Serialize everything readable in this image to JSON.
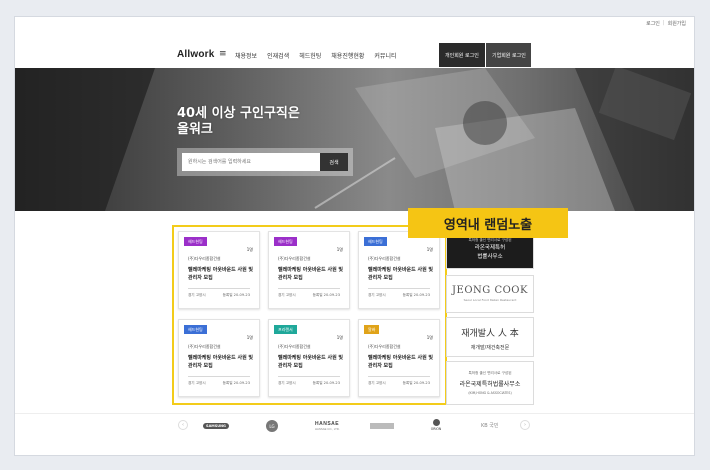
{
  "util": {
    "login": "로그인",
    "join": "회원가입"
  },
  "header": {
    "logo": "Allwork",
    "nav": [
      "채용정보",
      "인재검색",
      "헤드헌팅",
      "채용진행현황",
      "커뮤니티"
    ],
    "login_personal": "개인회원 로그인",
    "login_company": "기업회원 로그인"
  },
  "hero": {
    "title_line1": "40세 이상 구인구직은",
    "title_line2": "올워크",
    "search_placeholder": "원하시는 검색어를 입력하세요",
    "search_button": "검색"
  },
  "highlight_label": "영역내 랜덤노출",
  "cards": [
    {
      "tag": "헤드헌팅",
      "tag_color": "#9b2fc9",
      "count": "1명",
      "company": "(주)다우리종합건설",
      "title": "텔레마케팅 아웃바운드 사원 및 관리자 모집",
      "career": "경기 고양시",
      "date": "등록일 20-09-23"
    },
    {
      "tag": "헤드헌팅",
      "tag_color": "#9b2fc9",
      "count": "1명",
      "company": "(주)다우리종합건설",
      "title": "텔레마케팅 아웃바운드 사원 및 관리자 모집",
      "career": "경기 고양시",
      "date": "등록일 20-09-23"
    },
    {
      "tag": "헤드헌팅",
      "tag_color": "#3b6fd6",
      "count": "1명",
      "company": "(주)다우리종합건설",
      "title": "텔레마케팅 아웃바운드 사원 및 관리자 모집",
      "career": "경기 고양시",
      "date": "등록일 20-09-23"
    },
    {
      "tag": "헤드헌팅",
      "tag_color": "#3b6fd6",
      "count": "1명",
      "company": "(주)다우리종합건설",
      "title": "텔레마케팅 아웃바운드 사원 및 관리자 모집",
      "career": "경기 고양시",
      "date": "등록일 20-09-23"
    },
    {
      "tag": "프리랜서",
      "tag_color": "#1fa89a",
      "count": "1명",
      "company": "(주)다우리종합건설",
      "title": "텔레마케팅 아웃바운드 사원 및 관리자 모집",
      "career": "경기 고양시",
      "date": "등록일 20-09-23"
    },
    {
      "tag": "알바",
      "tag_color": "#e0a319",
      "count": "1명",
      "company": "(주)다우리종합건설",
      "title": "텔레마케팅 아웃바운드 사원 및 관리자 모집",
      "career": "경기 고양시",
      "date": "등록일 20-09-23"
    }
  ],
  "ads": {
    "ad1_small": "특허청 출신 변리사로 구성된",
    "ad1_line1": "라온국제특허",
    "ad1_line2": "법률사무소",
    "ad2_big": "JEONG COOK",
    "ad2_sub": "Seoul Local Food Italian Restaurant",
    "ad3_logo": "재개발人 人 本",
    "ad3_sub": "재개발/재건축전문",
    "ad4_small": "특허청 출신 변리사로 구성된",
    "ad4_main": "라온국제특허법률사무소",
    "ad4_en": "(KIM,HONG & ASSOCIATES)"
  },
  "partners": {
    "samsung": "SAMSUNG",
    "lg": "LG",
    "hansae": "HANSAE",
    "hansae_sub": "HANSAE CO., LTD.",
    "orion": "ORION",
    "kb": "KB 국민"
  }
}
